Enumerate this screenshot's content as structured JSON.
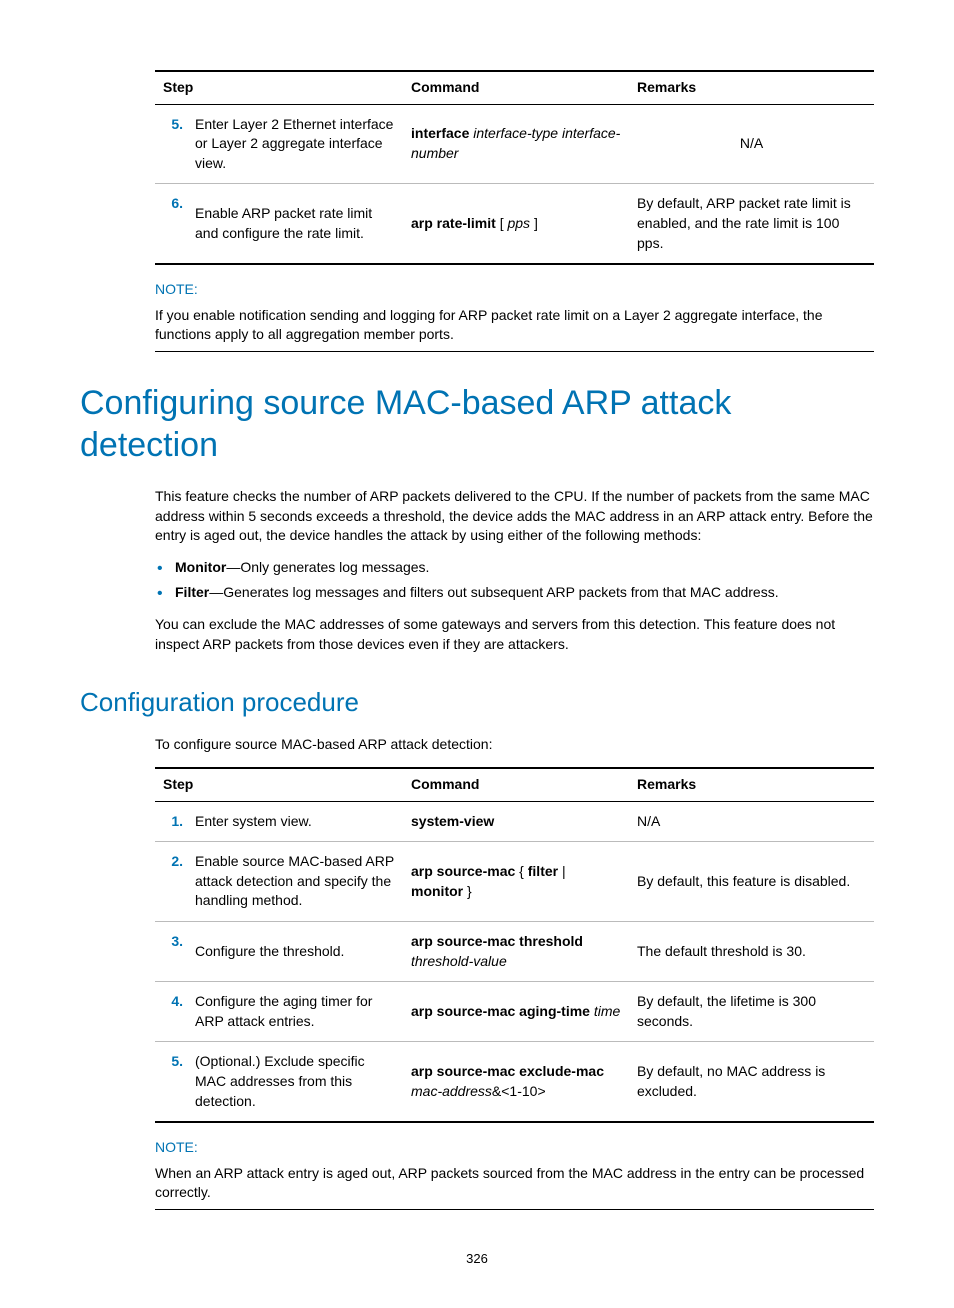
{
  "table1": {
    "headers": {
      "step": "Step",
      "command": "Command",
      "remarks": "Remarks"
    },
    "rows": [
      {
        "num": "5.",
        "desc": "Enter Layer 2 Ethernet interface or Layer 2 aggregate interface view.",
        "cmd_bold": "interface",
        "cmd_italic1": "interface-type interface-number",
        "remarks": "N/A"
      },
      {
        "num": "6.",
        "desc": "Enable ARP packet rate limit and configure the rate limit.",
        "cmd_bold": "arp rate-limit",
        "cmd_bracket_open": " [ ",
        "cmd_italic1": "pps",
        "cmd_bracket_close": " ]",
        "remarks": "By default, ARP packet rate limit is enabled, and the rate limit is 100 pps."
      }
    ]
  },
  "note1": {
    "label": "NOTE:",
    "text": "If you enable notification sending and logging for ARP packet rate limit on a Layer 2 aggregate interface, the functions apply to all aggregation member ports."
  },
  "h1": "Configuring source MAC-based ARP attack detection",
  "para1": "This feature checks the number of ARP packets delivered to the CPU. If the number of packets from the same MAC address within 5 seconds exceeds a threshold, the device adds the MAC address in an ARP attack entry. Before the entry is aged out, the device handles the attack by using either of the following methods:",
  "bullets": [
    {
      "bold": "Monitor",
      "text": "—Only generates log messages."
    },
    {
      "bold": "Filter",
      "text": "—Generates log messages and filters out subsequent ARP packets from that MAC address."
    }
  ],
  "para2": "You can exclude the MAC addresses of some gateways and servers from this detection. This feature does not inspect ARP packets from those devices even if they are attackers.",
  "h2": "Configuration procedure",
  "para3": "To configure source MAC-based ARP attack detection:",
  "table2": {
    "headers": {
      "step": "Step",
      "command": "Command",
      "remarks": "Remarks"
    },
    "rows": [
      {
        "num": "1.",
        "desc": "Enter system view.",
        "cmd_bold": "system-view",
        "remarks": "N/A"
      },
      {
        "num": "2.",
        "desc": "Enable source MAC-based ARP attack detection and specify the handling method.",
        "cmd_bold1": "arp source-mac",
        "brace_open": " { ",
        "cmd_bold2": "filter",
        "pipe": " | ",
        "cmd_bold3": "monitor",
        "brace_close": " }",
        "remarks": "By default, this feature is disabled."
      },
      {
        "num": "3.",
        "desc": "Configure the threshold.",
        "cmd_bold": "arp source-mac threshold",
        "cmd_italic": "threshold-value",
        "remarks": "The default threshold is 30."
      },
      {
        "num": "4.",
        "desc": "Configure the aging timer for ARP attack entries.",
        "cmd_bold": "arp source-mac aging-time",
        "cmd_italic": "time",
        "remarks": "By default, the lifetime is 300 seconds."
      },
      {
        "num": "5.",
        "desc": "(Optional.) Exclude specific MAC addresses from this detection.",
        "cmd_bold": "arp source-mac exclude-mac",
        "cmd_italic": "mac-address",
        "cmd_plain": "&<1-10>",
        "remarks": "By default, no MAC address is excluded."
      }
    ]
  },
  "note2": {
    "label": "NOTE:",
    "text": "When an ARP attack entry is aged out, ARP packets sourced from the MAC address in the entry can be processed correctly."
  },
  "pageNumber": "326"
}
